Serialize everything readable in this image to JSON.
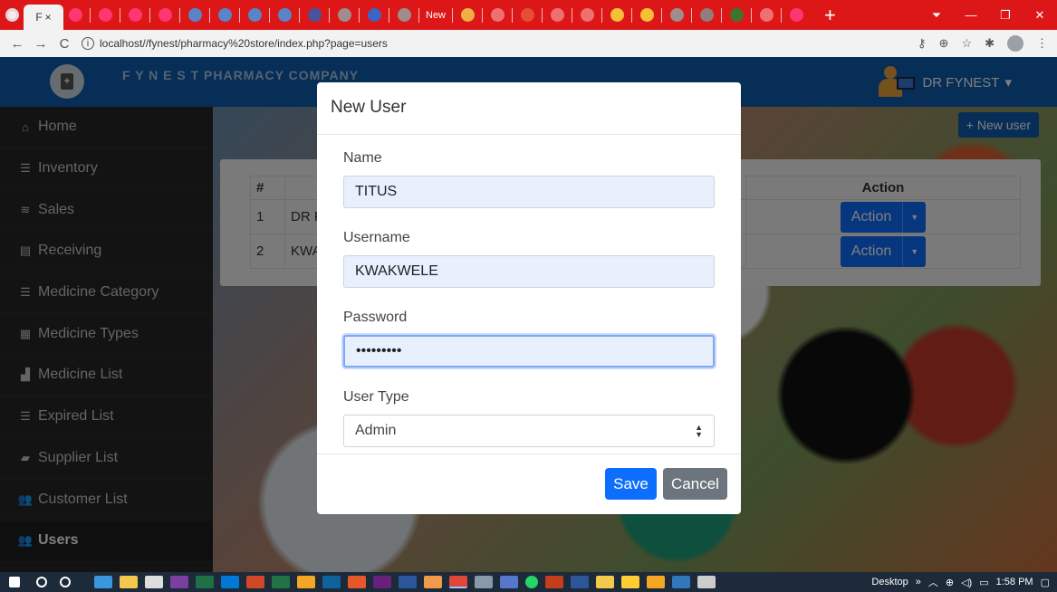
{
  "browser": {
    "active_tab_label": "F",
    "tab_text_new": "New",
    "url": "localhost//fynest/pharmacy%20store/index.php?page=users",
    "back_glyph": "←",
    "forward_glyph": "→",
    "reload_glyph": "C",
    "info_glyph": "i",
    "close_glyph": "×",
    "newtab_glyph": "+",
    "minimize_glyph": "—",
    "maximize_glyph": "❐",
    "winclose_glyph": "✕",
    "right_icons": [
      "key-icon",
      "zoom-icon",
      "star-icon",
      "puzzle-icon",
      "profile-icon",
      "more-icon"
    ]
  },
  "header": {
    "brand": "F Y N E S T PHARMACY COMPANY",
    "user_name": "DR FYNEST",
    "user_caret": "▾",
    "logo_glyph": "+"
  },
  "sidebar": {
    "items": [
      {
        "label": "Home",
        "icon": "home-icon",
        "glyph": "⌂"
      },
      {
        "label": "Inventory",
        "icon": "list-icon",
        "glyph": "☰"
      },
      {
        "label": "Sales",
        "icon": "coins-icon",
        "glyph": "≋"
      },
      {
        "label": "Receiving",
        "icon": "file-icon",
        "glyph": "▤"
      },
      {
        "label": "Medicine Category",
        "icon": "list-icon",
        "glyph": "☰"
      },
      {
        "label": "Medicine Types",
        "icon": "table-icon",
        "glyph": "▦"
      },
      {
        "label": "Medicine List",
        "icon": "boxes-icon",
        "glyph": "▟"
      },
      {
        "label": "Expired List",
        "icon": "list-icon",
        "glyph": "☰"
      },
      {
        "label": "Supplier List",
        "icon": "truck-icon",
        "glyph": "▰"
      },
      {
        "label": "Customer List",
        "icon": "user-friends-icon",
        "glyph": "👥"
      },
      {
        "label": "Users",
        "icon": "users-icon",
        "glyph": "👥"
      }
    ]
  },
  "main": {
    "new_user_label": "New user",
    "new_user_glyph": "+",
    "table": {
      "headers": {
        "num": "#",
        "name": "",
        "action": "Action"
      },
      "rows": [
        {
          "num": "1",
          "name": "DR F",
          "action": "Action"
        },
        {
          "num": "2",
          "name": "KWA",
          "action": "Action"
        }
      ]
    }
  },
  "modal": {
    "title": "New User",
    "name_label": "Name",
    "name_value": "TITUS",
    "username_label": "Username",
    "username_value": "KWAKWELE",
    "password_label": "Password",
    "password_value": "•••••••••",
    "usertype_label": "User Type",
    "usertype_value": "Admin",
    "select_up": "▲",
    "select_down": "▼",
    "save_label": "Save",
    "cancel_label": "Cancel"
  },
  "taskbar": {
    "desktop_label": "Desktop",
    "chevron": "»",
    "time": "1:58 PM"
  },
  "colors": {
    "chrome_red": "#dd1717",
    "brand_blue": "#0d5cad",
    "primary": "#0d6efd",
    "secondary": "#6c757d",
    "sidebar_bg": "#262626"
  }
}
